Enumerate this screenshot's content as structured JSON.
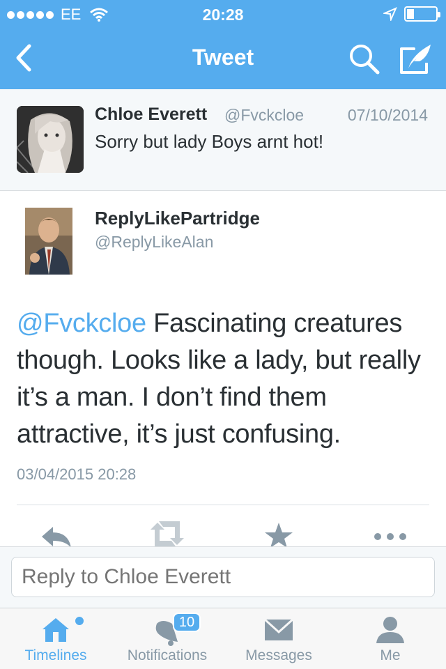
{
  "status_bar": {
    "carrier": "EE",
    "time": "20:28",
    "battery_level": 0.25
  },
  "nav": {
    "title": "Tweet",
    "icons": [
      "back-chevron-icon",
      "search-icon",
      "compose-icon"
    ]
  },
  "original_tweet": {
    "name": "Chloe Everett",
    "handle": "@Fvckcloe",
    "date": "07/10/2014",
    "text": "Sorry but lady Boys arnt hot!"
  },
  "main_tweet": {
    "name": "ReplyLikePartridge",
    "handle": "@ReplyLikeAlan",
    "mention": "@Fvckcloe",
    "text": " Fascinating creatures though. Looks like a lady, but really it’s a man. I don’t find them attractive, it’s just confusing.",
    "timestamp": "03/04/2015 20:28"
  },
  "actions": [
    "reply-icon",
    "retweet-icon",
    "favorite-icon",
    "more-icon"
  ],
  "reply": {
    "placeholder": "Reply to Chloe Everett"
  },
  "tabs": [
    {
      "label": "Timelines",
      "icon": "home-icon",
      "active": true
    },
    {
      "label": "Notifications",
      "icon": "notifications-icon",
      "badge": "10"
    },
    {
      "label": "Messages",
      "icon": "messages-icon"
    },
    {
      "label": "Me",
      "icon": "profile-icon"
    }
  ],
  "colors": {
    "accent": "#55acee",
    "muted": "#8899a6",
    "text": "#292f33"
  }
}
